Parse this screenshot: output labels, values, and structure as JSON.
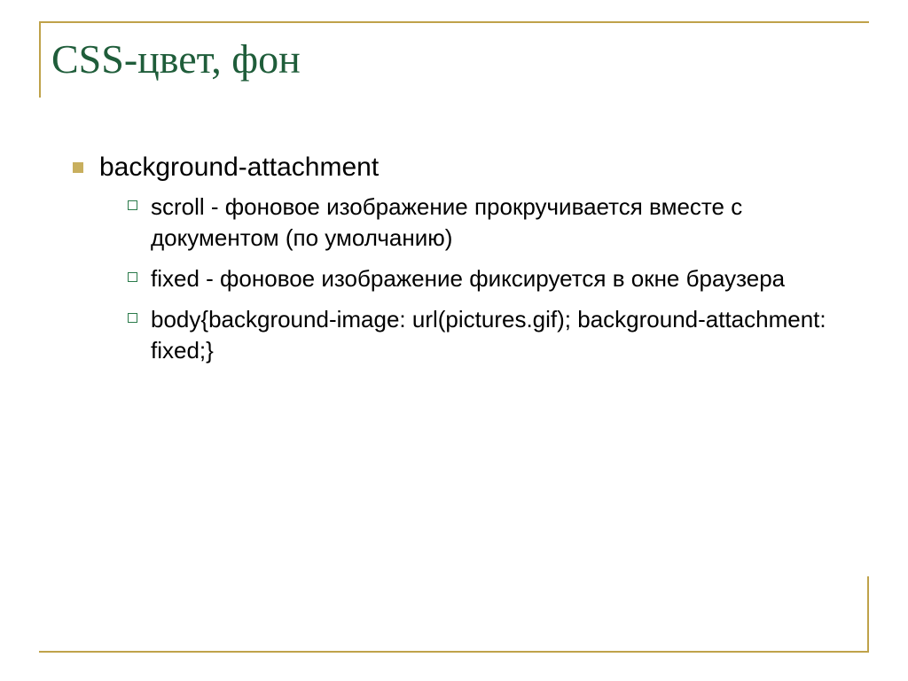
{
  "title": "CSS-цвет, фон",
  "bullets": {
    "item1": {
      "label": "background-attachment",
      "sub": {
        "a": "scroll - фоновое изображение прокручивается вместе с документом (по умолчанию)",
        "b": "fixed  - фоновое изображение фиксируется в окне браузера",
        "c": "body{background-image: url(pictures.gif); background-attachment: fixed;}"
      }
    }
  },
  "colors": {
    "title": "#1f5d3a",
    "accent": "#bfa24a",
    "bullet_l1_fill": "#c8af5e",
    "bullet_l2_border": "#2a7a4a"
  }
}
